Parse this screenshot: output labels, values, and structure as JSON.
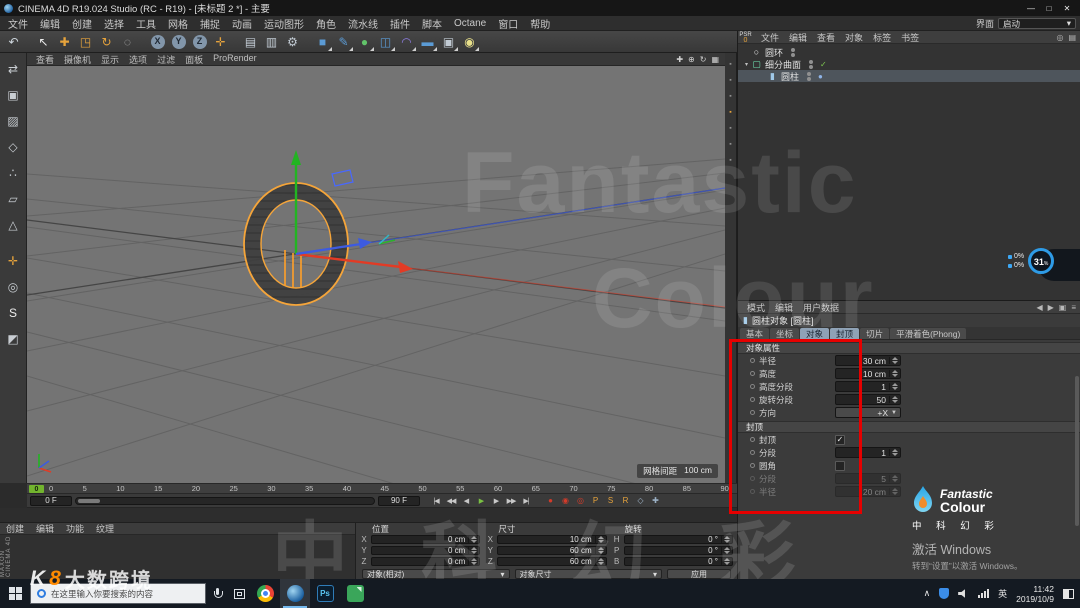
{
  "colors": {
    "accent_orange": "#e6a33c",
    "axis_x": "#e23b25",
    "axis_y": "#22b422",
    "axis_z": "#3d5be0",
    "annotation_red": "#e60000",
    "playhead_green": "#72b42e",
    "gauge_blue": "#2e9be6"
  },
  "titlebar": {
    "title": "CINEMA 4D R19.024 Studio (RC - R19) - [未标题 2 *] - 主要",
    "minimize": "—",
    "maximize": "□",
    "close": "✕"
  },
  "menubar": {
    "items": [
      "文件",
      "编辑",
      "创建",
      "选择",
      "工具",
      "网格",
      "捕捉",
      "动画",
      "运动图形",
      "角色",
      "流水线",
      "插件",
      "脚本",
      "Octane",
      "窗口",
      "帮助"
    ],
    "layout_label": "界面",
    "layout_value": "启动",
    "layout_arrow": "▾"
  },
  "toolbar": {
    "items": [
      {
        "name": "undo-icon",
        "glyph": "↶",
        "color": "#cdd5dc"
      },
      {
        "name": "live-selection-icon",
        "glyph": "↖",
        "color": "#ececec",
        "gap": true
      },
      {
        "name": "move-tool-icon",
        "glyph": "✚",
        "color": "#e6a33c"
      },
      {
        "name": "scale-tool-icon",
        "glyph": "◳",
        "color": "#e6a33c"
      },
      {
        "name": "rotate-tool-icon",
        "glyph": "↻",
        "color": "#e6a33c"
      },
      {
        "name": "last-tool-icon",
        "glyph": "◌",
        "color": "#b5b5b5"
      },
      {
        "name": "x-axis-lock-icon",
        "glyph": "X",
        "circle": true,
        "gap": true
      },
      {
        "name": "y-axis-lock-icon",
        "glyph": "Y",
        "circle": true
      },
      {
        "name": "z-axis-lock-icon",
        "glyph": "Z",
        "circle": true
      },
      {
        "name": "coordinate-system-icon",
        "glyph": "✛",
        "color": "#e6a33c"
      },
      {
        "name": "render-view-icon",
        "glyph": "▤",
        "color": "#c2cbd4",
        "gap": true
      },
      {
        "name": "render-picture-viewer-icon",
        "glyph": "▥",
        "color": "#c2cbd4"
      },
      {
        "name": "render-settings-icon",
        "glyph": "⚙",
        "color": "#c2cbd4"
      },
      {
        "name": "primitive-cube-icon",
        "glyph": "■",
        "color": "#5b9bd5",
        "dd": true,
        "gap": true
      },
      {
        "name": "spline-pen-icon",
        "glyph": "✎",
        "color": "#5b9bd5",
        "dd": true
      },
      {
        "name": "subdivision-surface-icon",
        "glyph": "●",
        "color": "#62c46a",
        "dd": true
      },
      {
        "name": "array-icon",
        "glyph": "◫",
        "color": "#5b9bd5",
        "dd": true
      },
      {
        "name": "bend-deformer-icon",
        "glyph": "◠",
        "color": "#8d7ce2",
        "dd": true
      },
      {
        "name": "floor-icon",
        "glyph": "▬",
        "color": "#5b9bd5",
        "dd": true
      },
      {
        "name": "camera-icon",
        "glyph": "▣",
        "color": "#c2cbd4",
        "dd": true
      },
      {
        "name": "light-icon",
        "glyph": "◉",
        "color": "#e8e08a",
        "dd": true
      }
    ]
  },
  "left_toolbar": {
    "items": [
      {
        "name": "make-editable-icon",
        "glyph": "⇄",
        "color": "#c8cdd2"
      },
      {
        "name": "model-mode-icon",
        "glyph": "▣",
        "color": "#c8cdd2"
      },
      {
        "name": "texture-mode-icon",
        "glyph": "▨",
        "color": "#c8cdd2"
      },
      {
        "name": "workplane-mode-icon",
        "glyph": "◇",
        "color": "#c8cdd2"
      },
      {
        "name": "points-mode-icon",
        "glyph": "∴",
        "color": "#c8cdd2"
      },
      {
        "name": "edges-mode-icon",
        "glyph": "▱",
        "color": "#c8cdd2"
      },
      {
        "name": "polygons-mode-icon",
        "glyph": "△",
        "color": "#c8cdd2"
      },
      {
        "name": "enable-axis-icon",
        "glyph": "✛",
        "color": "#e6a33c",
        "gap": true
      },
      {
        "name": "viewport-solo-icon",
        "glyph": "◎",
        "color": "#c8cdd2"
      },
      {
        "name": "enable-snap-icon",
        "glyph": "S",
        "color": "#ececec"
      },
      {
        "name": "workplane-lock-icon",
        "glyph": "◩",
        "color": "#c8cdd2"
      }
    ]
  },
  "viewport": {
    "menu": [
      "查看",
      "摄像机",
      "显示",
      "选项",
      "过滤",
      "面板",
      "ProRender"
    ],
    "view_icons": [
      {
        "name": "pan-view-icon",
        "glyph": "✚"
      },
      {
        "name": "zoom-view-icon",
        "glyph": "⊕"
      },
      {
        "name": "rotate-view-icon",
        "glyph": "↻"
      },
      {
        "name": "toggle-layout-icon",
        "glyph": "▦"
      }
    ],
    "grid_label": "网格间距",
    "grid_value": "100 cm"
  },
  "palette_strip": {
    "items": [
      {
        "name": "palette-icon",
        "glyph": "▪",
        "color": "#909090"
      },
      {
        "name": "palette-icon",
        "glyph": "▪",
        "color": "#909090"
      },
      {
        "name": "palette-icon",
        "glyph": "▪",
        "color": "#909090"
      },
      {
        "name": "palette-icon",
        "glyph": "▪",
        "color": "#e6a33c"
      },
      {
        "name": "palette-icon",
        "glyph": "▪",
        "color": "#909090"
      },
      {
        "name": "palette-icon",
        "glyph": "▪",
        "color": "#909090"
      },
      {
        "name": "palette-icon",
        "glyph": "▪",
        "color": "#909090"
      }
    ]
  },
  "object_manager": {
    "psr": "PSR",
    "psr_value": "0",
    "menu": [
      "文件",
      "编辑",
      "查看",
      "对象",
      "标签",
      "书签"
    ],
    "icons": [
      {
        "name": "om-search-icon",
        "glyph": "◎"
      },
      {
        "name": "om-filter-icon",
        "glyph": "▤"
      }
    ],
    "objects": [
      {
        "name": "圆环",
        "icon": "○",
        "icon_color": "#ececec",
        "expander": "",
        "tag1": "",
        "indent": false
      },
      {
        "name": "细分曲面",
        "icon": "▢",
        "icon_color": "#6ee0b0",
        "expander": "▾",
        "tag1": "✓",
        "tag1_color": "#7ec850",
        "indent": false
      },
      {
        "name": "圆柱",
        "icon": "▮",
        "icon_color": "#9fc8e8",
        "expander": "",
        "tag1": "●",
        "tag1_color": "#8fb4e8",
        "indent": true,
        "selected": true
      }
    ]
  },
  "attributes": {
    "mode_menu": [
      "模式",
      "编辑",
      "用户数据"
    ],
    "mode_icons": [
      {
        "name": "history-back-icon",
        "glyph": "◀"
      },
      {
        "name": "history-forward-icon",
        "glyph": "▶"
      },
      {
        "name": "pin-icon",
        "glyph": "▣"
      },
      {
        "name": "panel-menu-icon",
        "glyph": "≡"
      }
    ],
    "title_icon": "▮",
    "title": "圆柱对象 [圆柱]",
    "tabs": [
      {
        "label": "基本",
        "active": false
      },
      {
        "label": "坐标",
        "active": false
      },
      {
        "label": "对象",
        "active": true
      },
      {
        "label": "封顶",
        "active": true
      },
      {
        "label": "切片",
        "active": false
      },
      {
        "label": "平滑着色(Phong)",
        "active": false
      }
    ],
    "object_section_title": "对象属性",
    "object_props": [
      {
        "label": "半径",
        "value": "30 cm",
        "spin": true
      },
      {
        "label": "高度",
        "value": "10 cm",
        "spin": true
      },
      {
        "label": "高度分段",
        "value": "1",
        "spin": true
      },
      {
        "label": "旋转分段",
        "value": "50",
        "spin": true
      },
      {
        "label": "方向",
        "value": "+X",
        "dropdown": true,
        "arrow": "▼"
      }
    ],
    "cap_section_title": "封顶",
    "cap_props": [
      {
        "label": "封顶",
        "checkbox": true,
        "checked": true
      },
      {
        "label": "分段",
        "value": "1",
        "spin": true
      },
      {
        "label": "圆角",
        "checkbox": true,
        "checked": false
      },
      {
        "label": "分段",
        "value": "5",
        "spin": true,
        "disabled": true
      },
      {
        "label": "半径",
        "value": "20 cm",
        "spin": true,
        "disabled": true
      }
    ]
  },
  "timeline": {
    "playhead": "0",
    "ticks": [
      "0",
      "5",
      "10",
      "15",
      "20",
      "25",
      "30",
      "35",
      "40",
      "45",
      "50",
      "55",
      "60",
      "65",
      "70",
      "75",
      "80",
      "85",
      "90"
    ]
  },
  "animbar": {
    "current": "0 F",
    "end": "90 F",
    "transport": [
      {
        "name": "goto-start-button",
        "glyph": "|◀"
      },
      {
        "name": "prev-key-button",
        "glyph": "◀◀"
      },
      {
        "name": "prev-frame-button",
        "glyph": "◀"
      },
      {
        "name": "play-button",
        "glyph": "▶",
        "color": "#7ac143"
      },
      {
        "name": "next-frame-button",
        "glyph": "▶"
      },
      {
        "name": "next-key-button",
        "glyph": "▶▶"
      },
      {
        "name": "goto-end-button",
        "glyph": "▶|"
      }
    ],
    "record": [
      {
        "name": "record-keyframe-button",
        "glyph": "●",
        "color": "#d23b2a"
      },
      {
        "name": "autokey-button",
        "glyph": "◉",
        "color": "#d23b2a"
      },
      {
        "name": "keyframe-selection-button",
        "glyph": "◎",
        "color": "#d23b2a"
      },
      {
        "name": "record-position-toggle",
        "glyph": "P",
        "color": "#e6a33c"
      },
      {
        "name": "record-scale-toggle",
        "glyph": "S",
        "color": "#e6a33c"
      },
      {
        "name": "record-rotation-toggle",
        "glyph": "R",
        "color": "#e6a33c"
      },
      {
        "name": "record-parameter-toggle",
        "glyph": "◇",
        "color": "#9bb0c4"
      },
      {
        "name": "record-pla-toggle",
        "glyph": "✚",
        "color": "#9bb0c4"
      }
    ]
  },
  "material_manager": {
    "menu": [
      "创建",
      "编辑",
      "功能",
      "纹理"
    ],
    "brand_vertical": "MAXON CINEMA 4D"
  },
  "coordinates": {
    "position": {
      "label": "位置",
      "rows": [
        {
          "axis": "X",
          "value": "0 cm"
        },
        {
          "axis": "Y",
          "value": "0 cm"
        },
        {
          "axis": "Z",
          "value": "0 cm"
        }
      ]
    },
    "size": {
      "label": "尺寸",
      "rows": [
        {
          "axis": "X",
          "value": "10 cm"
        },
        {
          "axis": "Y",
          "value": "60 cm"
        },
        {
          "axis": "Z",
          "value": "60 cm"
        }
      ]
    },
    "rotation": {
      "label": "旋转",
      "rows": [
        {
          "axis": "H",
          "value": "0 °"
        },
        {
          "axis": "P",
          "value": "0 °"
        },
        {
          "axis": "B",
          "value": "0 °"
        }
      ]
    },
    "mode_select": "对象(相对)",
    "size_select": "对象尺寸",
    "apply_button": "应用",
    "arrow": "▾"
  },
  "perf": {
    "rows": [
      "0%",
      "0%"
    ],
    "gauge": "31",
    "unit": "%"
  },
  "watermarks": {
    "line1": "Fantastic",
    "line2": "Colour",
    "cn": "中 科 幻 彩",
    "side_logo_k": "K",
    "side_logo_8": "8",
    "side": "大数跨境"
  },
  "brand_corner": {
    "name1": "Fantastic",
    "name2": "Colour",
    "cn": "中 科 幻 彩",
    "activate1": "激活 Windows",
    "activate2": "转到“设置”以激活 Windows。"
  },
  "taskbar": {
    "search": "在这里输入你要搜索的内容",
    "lang": "英",
    "time": "11:42",
    "date": "2019/10/9",
    "apps": [
      {
        "name": "chrome-icon",
        "chrome": true
      },
      {
        "name": "cinema4d-icon",
        "c4d": true,
        "active": true
      },
      {
        "name": "photoshop-icon",
        "ps": true,
        "label": "Ps"
      },
      {
        "name": "green-app-icon",
        "green": true
      }
    ]
  }
}
